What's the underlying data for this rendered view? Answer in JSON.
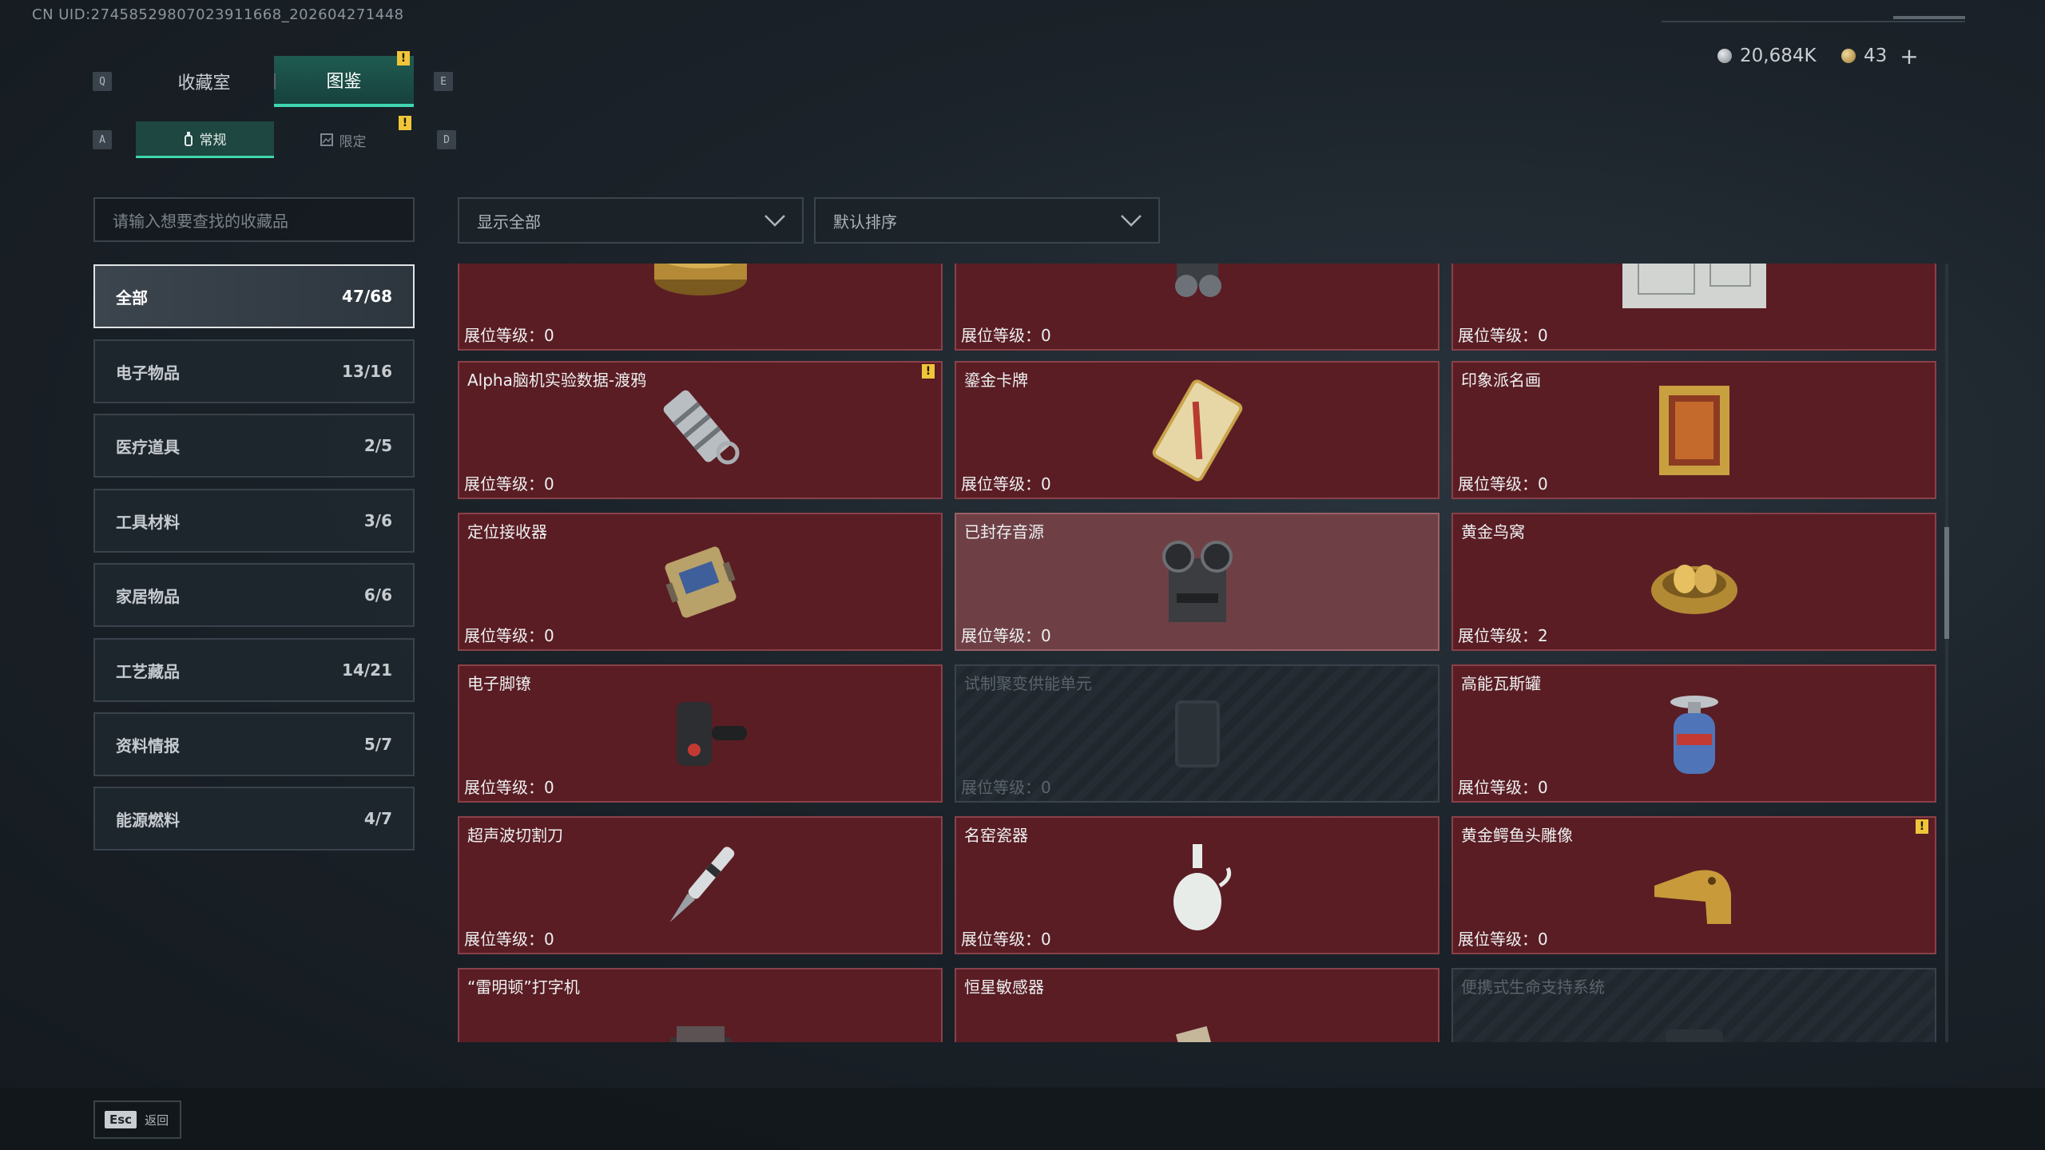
{
  "uid": "CN UID:274585298070239116​68_202604271448",
  "currency": {
    "coins": "20,684K",
    "tickets": "43",
    "add": "+"
  },
  "keys": {
    "q": "Q",
    "e": "E",
    "a": "A",
    "d": "D"
  },
  "tabs": [
    {
      "label": "收藏室"
    },
    {
      "label": "图鉴"
    }
  ],
  "subtabs": [
    {
      "label": "常规"
    },
    {
      "label": "限定"
    }
  ],
  "search": {
    "placeholder": "请输入想要查找的收藏品"
  },
  "categories": [
    {
      "label": "全部",
      "count": "47/68"
    },
    {
      "label": "电子物品",
      "count": "13/16"
    },
    {
      "label": "医疗道具",
      "count": "2/5"
    },
    {
      "label": "工具材料",
      "count": "3/6"
    },
    {
      "label": "家居物品",
      "count": "6/6"
    },
    {
      "label": "工艺藏品",
      "count": "14/21"
    },
    {
      "label": "资料情报",
      "count": "5/7"
    },
    {
      "label": "能源燃料",
      "count": "4/7"
    }
  ],
  "filters": {
    "show": "显示全部",
    "sort": "默认排序"
  },
  "level_label": "展位等级：",
  "notice": "!",
  "items": [
    {
      "name": "",
      "level": "0",
      "icon": "caviar-tin-icon"
    },
    {
      "name": "",
      "level": "0",
      "icon": "radio-device-icon"
    },
    {
      "name": "",
      "level": "0",
      "icon": "blueprint-map-icon"
    },
    {
      "name": "Alpha脑机实验数据-渡鸦",
      "level": "0",
      "icon": "data-canister-icon"
    },
    {
      "name": "鎏金卡牌",
      "level": "0",
      "icon": "gilded-card-icon"
    },
    {
      "name": "印象派名画",
      "level": "0",
      "icon": "framed-painting-icon"
    },
    {
      "name": "定位接收器",
      "level": "0",
      "icon": "locator-receiver-icon"
    },
    {
      "name": "已封存音源",
      "level": "0",
      "icon": "reel-recorder-icon"
    },
    {
      "name": "黄金鸟窝",
      "level": "2",
      "icon": "golden-nest-icon"
    },
    {
      "name": "电子脚镣",
      "level": "0",
      "icon": "ankle-monitor-icon"
    },
    {
      "name": "试制聚变供能单元",
      "level": "0",
      "icon": "fusion-unit-icon"
    },
    {
      "name": "高能瓦斯罐",
      "level": "0",
      "icon": "gas-canister-icon"
    },
    {
      "name": "超声波切割刀",
      "level": "0",
      "icon": "ultrasonic-cutter-icon"
    },
    {
      "name": "名窑瓷器",
      "level": "0",
      "icon": "porcelain-vase-icon"
    },
    {
      "name": "黄金鳄鱼头雕像",
      "level": "0",
      "icon": "golden-crocodile-icon"
    },
    {
      "name": "“雷明顿”打字机",
      "level": "",
      "icon": "typewriter-icon"
    },
    {
      "name": "恒星敏感器",
      "level": "",
      "icon": "star-sensor-icon"
    },
    {
      "name": "便携式生命支持系统",
      "level": "",
      "icon": "life-support-icon"
    }
  ],
  "footer": {
    "esc": "Esc",
    "back": "返回"
  }
}
